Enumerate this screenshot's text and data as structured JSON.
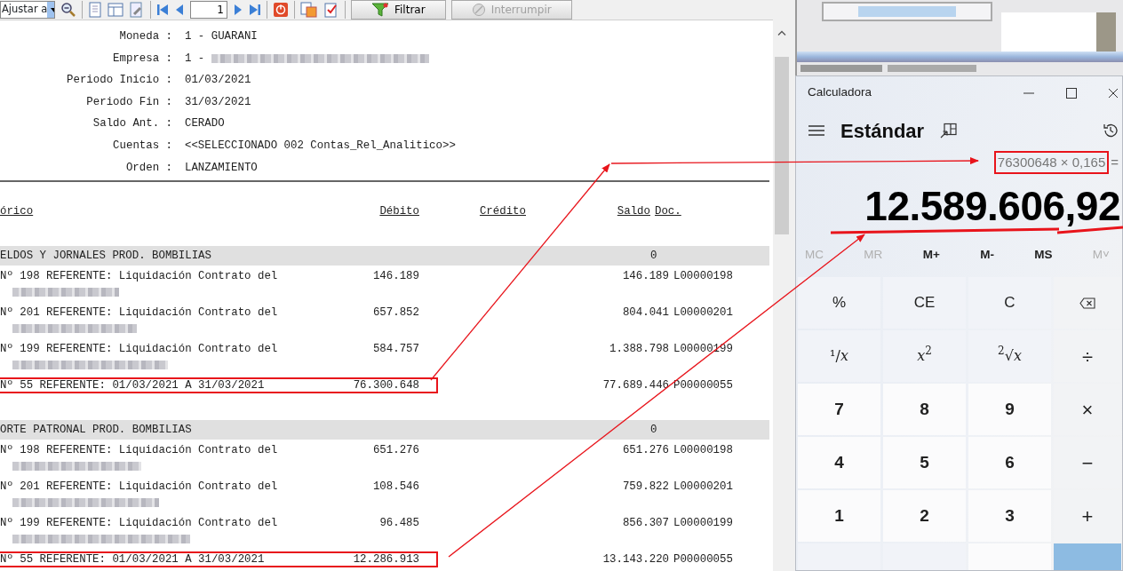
{
  "toolbar": {
    "zoom": "Ajustar a",
    "page": "1",
    "buttons": [
      {
        "label": "Filtrar",
        "disabled": false
      },
      {
        "label": "Interrumpir",
        "disabled": true
      }
    ]
  },
  "report": {
    "fields": [
      {
        "label": "Moneda :",
        "value": "1 - GUARANI"
      },
      {
        "label": "Empresa :",
        "value": "1 -",
        "blurred": true
      },
      {
        "label": "Periodo Inicio :",
        "value": "01/03/2021"
      },
      {
        "label": "Periodo Fin :",
        "value": "31/03/2021"
      },
      {
        "label": "Saldo Ant. :",
        "value": "CERADO"
      },
      {
        "label": "Cuentas :",
        "value": "<<SELECCIONADO 002 Contas_Rel_Analitico>>"
      },
      {
        "label": "Orden :",
        "value": "LANZAMIENTO"
      }
    ],
    "columns": [
      "órico",
      "Débito",
      "Crédito",
      "Saldo",
      "Doc."
    ],
    "groups": [
      {
        "title": "ELDOS Y JORNALES PROD. BOMBILIAS",
        "balance": "0",
        "rows": [
          {
            "description": "Nº 198 REFERENTE: Liquidación Contrato del",
            "name_blurred": true,
            "debit": "146.189",
            "balance": "146.189",
            "doc": "L00000198",
            "highlighted": false
          },
          {
            "description": "Nº 201 REFERENTE: Liquidación Contrato del",
            "name_blurred": true,
            "debit": "657.852",
            "balance": "804.041",
            "doc": "L00000201",
            "highlighted": false
          },
          {
            "description": "Nº 199 REFERENTE: Liquidación Contrato del",
            "name_blurred": true,
            "debit": "584.757",
            "balance": "1.388.798",
            "doc": "L00000199",
            "highlighted": false
          },
          {
            "description": "Nº 55 REFERENTE: 01/03/2021 A 31/03/2021",
            "name_blurred": false,
            "debit": "76.300.648",
            "balance": "77.689.446",
            "doc": "P00000055",
            "highlighted": true
          }
        ]
      },
      {
        "title": "ORTE PATRONAL PROD. BOMBILIAS",
        "balance": "0",
        "rows": [
          {
            "description": "Nº 198 REFERENTE: Liquidación Contrato del",
            "name_blurred": true,
            "debit": "651.276",
            "balance": "651.276",
            "doc": "L00000198",
            "highlighted": false
          },
          {
            "description": "Nº 201 REFERENTE: Liquidación Contrato del",
            "name_blurred": true,
            "debit": "108.546",
            "balance": "759.822",
            "doc": "L00000201",
            "highlighted": false
          },
          {
            "description": "Nº 199 REFERENTE: Liquidación Contrato del",
            "name_blurred": true,
            "debit": "96.485",
            "balance": "856.307",
            "doc": "L00000199",
            "highlighted": false
          },
          {
            "description": "Nº 55 REFERENTE: 01/03/2021 A 31/03/2021",
            "name_blurred": false,
            "debit": "12.286.913",
            "balance": "13.143.220",
            "doc": "P00000055",
            "highlighted": true
          }
        ]
      }
    ]
  },
  "calculator": {
    "title": "Calculadora",
    "mode": "Estándar",
    "expression": "76300648 × 0,165",
    "expression_highlighted": true,
    "equals": "=",
    "display": "12.589.606,92",
    "memory": [
      {
        "label": "MC",
        "disabled": true
      },
      {
        "label": "MR",
        "disabled": true
      },
      {
        "label": "M+",
        "disabled": false
      },
      {
        "label": "M-",
        "disabled": false
      },
      {
        "label": "MS",
        "disabled": false
      },
      {
        "label": "M˅",
        "disabled": true
      }
    ],
    "keys": [
      {
        "label": "%",
        "kind": "function"
      },
      {
        "label": "CE",
        "kind": "function"
      },
      {
        "label": "C",
        "kind": "function"
      },
      {
        "kind": "backspace"
      },
      {
        "label": "¹/*x*",
        "kind": "function"
      },
      {
        "label": "*x*$^{2}$",
        "kind": "function"
      },
      {
        "label": "$^{2}$√*x*",
        "kind": "function"
      },
      {
        "label": "÷",
        "kind": "operator"
      },
      {
        "label": "7",
        "kind": "digit"
      },
      {
        "label": "8",
        "kind": "digit"
      },
      {
        "label": "9",
        "kind": "digit"
      },
      {
        "label": "×",
        "kind": "operator"
      },
      {
        "label": "4",
        "kind": "digit"
      },
      {
        "label": "5",
        "kind": "digit"
      },
      {
        "label": "6",
        "kind": "digit"
      },
      {
        "label": "−",
        "kind": "operator"
      },
      {
        "label": "1",
        "kind": "digit"
      },
      {
        "label": "2",
        "kind": "digit"
      },
      {
        "label": "3",
        "kind": "digit"
      },
      {
        "label": "+",
        "kind": "operator"
      }
    ]
  }
}
